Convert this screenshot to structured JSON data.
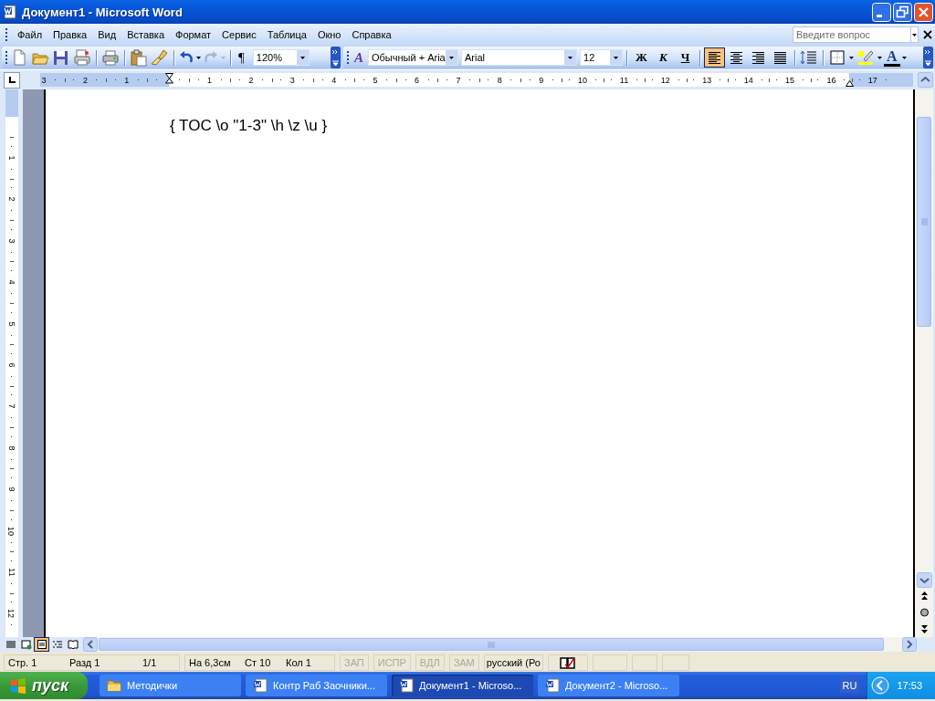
{
  "window": {
    "title": "Документ1 - Microsoft Word"
  },
  "menu": [
    {
      "label": "Файл"
    },
    {
      "label": "Правка"
    },
    {
      "label": "Вид"
    },
    {
      "label": "Вставка"
    },
    {
      "label": "Формат"
    },
    {
      "label": "Сервис"
    },
    {
      "label": "Таблица"
    },
    {
      "label": "Окно"
    },
    {
      "label": "Справка"
    }
  ],
  "help_search": {
    "placeholder": "Введите вопрос"
  },
  "standard_toolbar": {
    "show_marks": "¶",
    "zoom": "120%",
    "redo_disabled": true
  },
  "formatting_toolbar": {
    "styles_glyph": "A",
    "style": "Обычный + Aria",
    "font": "Arial",
    "size": "12",
    "text_buttons": [
      {
        "label": "Ж",
        "selected": false
      },
      {
        "label": "К",
        "selected": false
      },
      {
        "label": "Ч",
        "selected": false
      }
    ],
    "alignment": [
      {
        "selected": true
      },
      {
        "selected": false
      },
      {
        "selected": false
      },
      {
        "selected": false
      }
    ],
    "font_color_glyph": "A"
  },
  "horizontal_ruler": {
    "left_labels": [
      "3",
      "2",
      "1"
    ],
    "right_labels": [
      "1",
      "2",
      "3",
      "4",
      "5",
      "6",
      "7",
      "8",
      "9",
      "10",
      "11",
      "12",
      "13",
      "14",
      "15",
      "16",
      "17"
    ]
  },
  "vertical_ruler": {
    "labels": [
      "1",
      "2",
      "3",
      "4",
      "5",
      "6",
      "7",
      "8",
      "9",
      "10",
      "11",
      "12"
    ]
  },
  "document": {
    "field_code": "{ TOC \\o \"1-3\" \\h \\z \\u }"
  },
  "view_buttons": [
    {
      "selected": false
    },
    {
      "selected": false
    },
    {
      "selected": true
    },
    {
      "selected": false
    },
    {
      "selected": false
    }
  ],
  "status_bar": {
    "page": "Стр. 1",
    "section": "Разд 1",
    "pages": "1/1",
    "position": "На 6,3см",
    "line": "Ст 10",
    "column": "Кол 1",
    "modes": [
      {
        "label": "ЗАП",
        "on": false
      },
      {
        "label": "ИСПР",
        "on": false
      },
      {
        "label": "ВДЛ",
        "on": false
      },
      {
        "label": "ЗАМ",
        "on": false
      }
    ],
    "language": "русский (Ро"
  },
  "taskbar": {
    "start": "пуск",
    "tasks": [
      {
        "kind": "folder",
        "label": "Методички",
        "selected": false
      },
      {
        "kind": "word",
        "label": "Контр Раб Заочники...",
        "selected": false
      },
      {
        "kind": "word",
        "label": "Документ1 - Microso...",
        "selected": true
      },
      {
        "kind": "word",
        "label": "Документ2 - Microso...",
        "selected": false
      }
    ],
    "language": "RU",
    "clock": "17:53"
  }
}
